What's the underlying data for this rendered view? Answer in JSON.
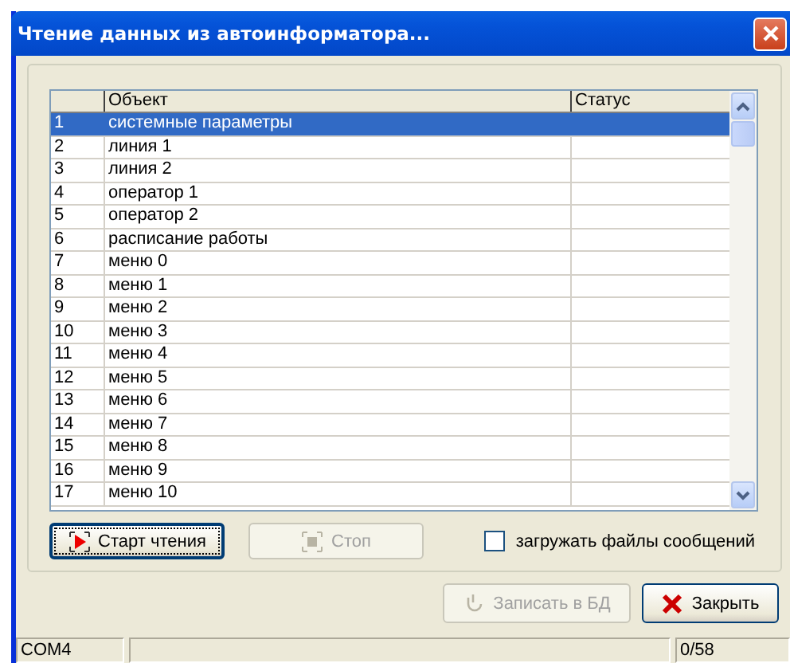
{
  "window": {
    "title": "Чтение данных из автоинформатора..."
  },
  "table": {
    "columns": [
      {
        "label": "Объект"
      },
      {
        "label": "Статус"
      }
    ],
    "rows": [
      {
        "number": "1",
        "object": "системные параметры",
        "selected": true
      },
      {
        "number": "2",
        "object": "линия 1",
        "selected": false
      },
      {
        "number": "3",
        "object": "линия 2",
        "selected": false
      },
      {
        "number": "4",
        "object": "оператор 1",
        "selected": false
      },
      {
        "number": "5",
        "object": "оператор 2",
        "selected": false
      },
      {
        "number": "6",
        "object": "расписание работы",
        "selected": false
      },
      {
        "number": "7",
        "object": "меню 0",
        "selected": false
      },
      {
        "number": "8",
        "object": "меню 1",
        "selected": false
      },
      {
        "number": "9",
        "object": "меню 2",
        "selected": false
      },
      {
        "number": "10",
        "object": "меню 3",
        "selected": false
      },
      {
        "number": "11",
        "object": "меню 4",
        "selected": false
      },
      {
        "number": "12",
        "object": "меню 5",
        "selected": false
      },
      {
        "number": "13",
        "object": "меню 6",
        "selected": false
      },
      {
        "number": "14",
        "object": "меню 7",
        "selected": false
      },
      {
        "number": "15",
        "object": "меню 8",
        "selected": false
      },
      {
        "number": "16",
        "object": "меню 9",
        "selected": false
      },
      {
        "number": "17",
        "object": "меню 10",
        "selected": false
      }
    ]
  },
  "controls": {
    "start": {
      "label": "Старт чтения",
      "disabled": false
    },
    "stop": {
      "label": "Стоп",
      "disabled": true
    },
    "load_files": {
      "label": "загружать файлы сообщений",
      "checked": false
    }
  },
  "buttons": {
    "save": {
      "label": "Записать в БД",
      "disabled": true
    },
    "close": {
      "label": "Закрыть",
      "disabled": false
    }
  },
  "status_bar": {
    "port": "COM4",
    "progress": "0/58"
  }
}
